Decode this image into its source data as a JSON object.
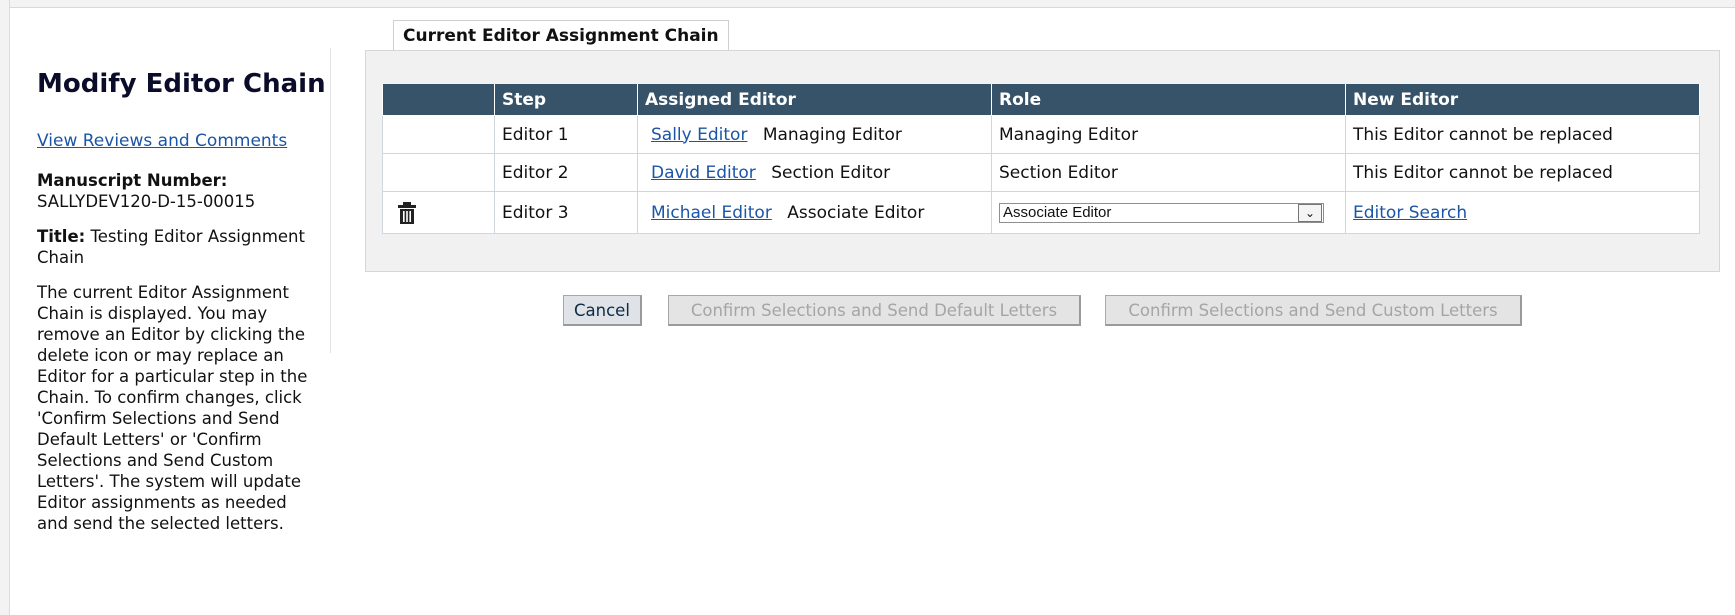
{
  "sidebar": {
    "title": "Modify Editor Chain",
    "reviews_link": "View Reviews and Comments",
    "manuscript_label": "Manuscript Number:",
    "manuscript_number": "SALLYDEV120-D-15-00015",
    "title_label": "Title:",
    "title_value": "Testing Editor Assignment Chain",
    "description": "The current Editor Assignment Chain is displayed. You may remove an Editor by clicking the delete icon or may replace an Editor for a particular step in the Chain. To confirm changes, click 'Confirm Selections and Send Default Letters' or 'Confirm Selections and Send Custom Letters'. The system will update Editor assignments as needed and send the selected letters."
  },
  "panel": {
    "tab_label": "Current Editor Assignment Chain",
    "headers": [
      "",
      "Step",
      "Assigned Editor",
      "Role",
      "New Editor"
    ],
    "rows": [
      {
        "step": "Editor 1",
        "editor_name": "Sally Editor",
        "editor_role": "Managing Editor",
        "role": "Managing Editor",
        "new_editor": "This Editor cannot be replaced"
      },
      {
        "step": "Editor 2",
        "editor_name": "David Editor",
        "editor_role": "Section Editor",
        "role": "Section Editor",
        "new_editor": "This Editor cannot be replaced"
      },
      {
        "step": "Editor 3",
        "editor_name": "Michael Editor",
        "editor_role": "Associate Editor",
        "role_select": "Associate Editor",
        "new_editor_link": "Editor Search",
        "icon": "trash-icon"
      }
    ]
  },
  "buttons": {
    "cancel": "Cancel",
    "default_letters": "Confirm Selections and Send Default Letters",
    "custom_letters": "Confirm Selections and Send Custom Letters"
  },
  "colors": {
    "header_bg": "#36536a",
    "link": "#1a55a8",
    "panel_bg": "#f1f1f1"
  }
}
